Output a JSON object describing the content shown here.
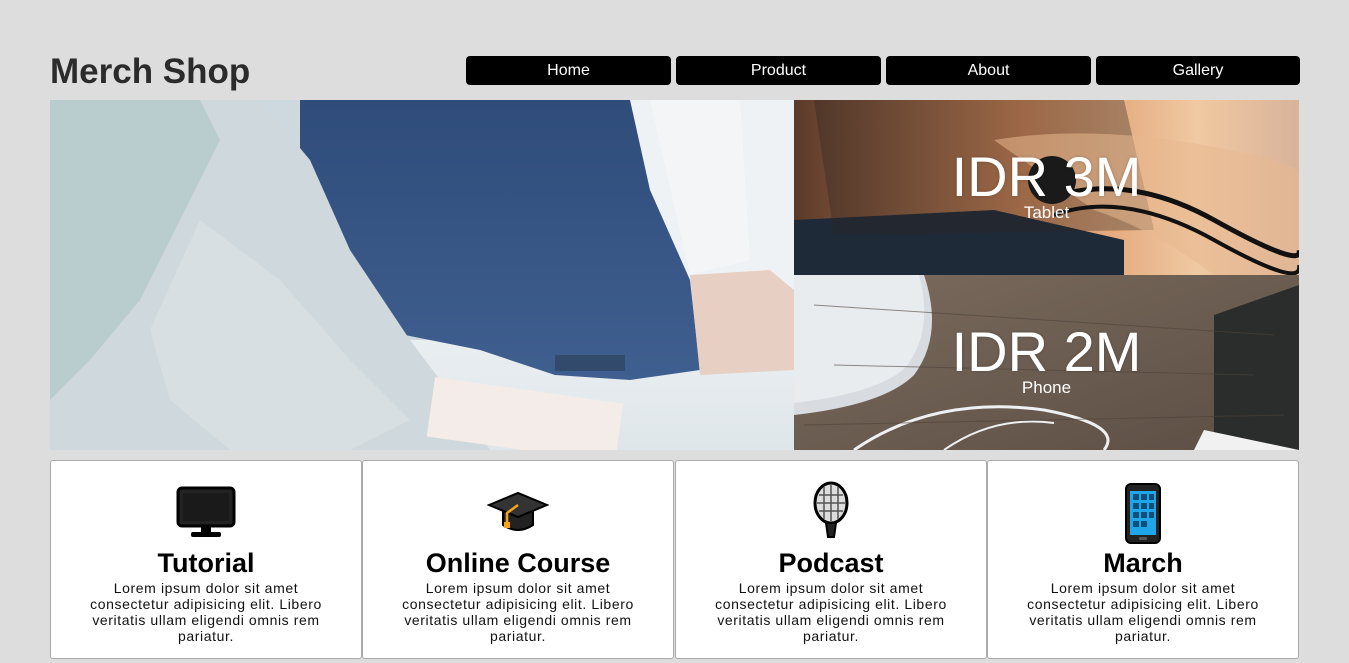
{
  "header": {
    "brand": "Merch Shop",
    "nav": [
      {
        "label": "Home"
      },
      {
        "label": "Product"
      },
      {
        "label": "About"
      },
      {
        "label": "Gallery"
      }
    ]
  },
  "promos": [
    {
      "price": "IDR 3M",
      "label": "Tablet"
    },
    {
      "price": "IDR 2M",
      "label": "Phone"
    }
  ],
  "cards": [
    {
      "icon": "computer-monitor-icon",
      "title": "Tutorial",
      "text": "Lorem ipsum dolor sit amet consectetur adipisicing elit. Libero veritatis ullam eligendi omnis rem pariatur."
    },
    {
      "icon": "graduation-cap-icon",
      "title": "Online Course",
      "text": "Lorem ipsum dolor sit amet consectetur adipisicing elit. Libero veritatis ullam eligendi omnis rem pariatur."
    },
    {
      "icon": "microphone-icon",
      "title": "Podcast",
      "text": "Lorem ipsum dolor sit amet consectetur adipisicing elit. Libero veritatis ullam eligendi omnis rem pariatur."
    },
    {
      "icon": "mobile-phone-icon",
      "title": "March",
      "text": "Lorem ipsum dolor sit amet consectetur adipisicing elit. Libero veritatis ullam eligendi omnis rem pariatur."
    }
  ],
  "colors": {
    "page_bg": "#dddddd",
    "nav_bg": "#000000",
    "nav_text": "#ffffff",
    "card_bg": "#ffffff"
  }
}
